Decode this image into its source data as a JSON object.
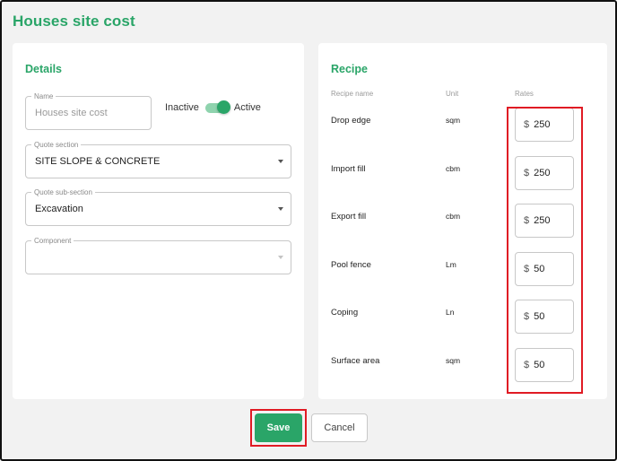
{
  "page": {
    "title": "Houses site cost"
  },
  "details": {
    "title": "Details",
    "name_field": {
      "label": "Name",
      "placeholder": "Houses site cost",
      "value": ""
    },
    "status_toggle": {
      "off_label": "Inactive",
      "on_label": "Active",
      "checked": true
    },
    "quote_section": {
      "label": "Quote section",
      "value": "SITE SLOPE & CONCRETE"
    },
    "quote_sub_section": {
      "label": "Quote sub-section",
      "value": "Excavation"
    },
    "component": {
      "label": "Component",
      "value": ""
    }
  },
  "recipe": {
    "title": "Recipe",
    "columns": {
      "name": "Recipe name",
      "unit": "Unit",
      "rates": "Rates"
    },
    "currency_symbol": "$",
    "rows": [
      {
        "name": "Drop edge",
        "unit": "sqm",
        "rate": "250"
      },
      {
        "name": "Import fill",
        "unit": "cbm",
        "rate": "250"
      },
      {
        "name": "Export fill",
        "unit": "cbm",
        "rate": "250"
      },
      {
        "name": "Pool fence",
        "unit": "Lm",
        "rate": "50"
      },
      {
        "name": "Coping",
        "unit": "Ln",
        "rate": "50"
      },
      {
        "name": "Surface area",
        "unit": "sqm",
        "rate": "50"
      }
    ]
  },
  "actions": {
    "save_label": "Save",
    "cancel_label": "Cancel"
  },
  "colors": {
    "accent": "#2aa568",
    "highlight": "#e01b24"
  }
}
